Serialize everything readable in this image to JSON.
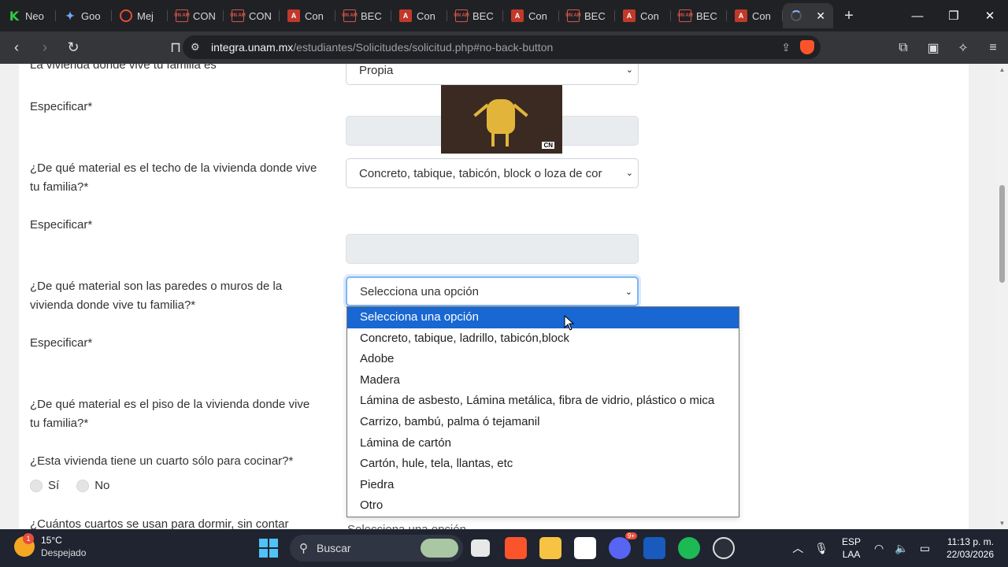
{
  "browser": {
    "tabs": [
      {
        "label": "Neo",
        "icon": "k-logo-icon"
      },
      {
        "label": "Goo",
        "icon": "gemini-star-icon"
      },
      {
        "label": "Mej",
        "icon": "record-icon"
      },
      {
        "label": "CON",
        "icon": "unam-icon"
      },
      {
        "label": "CON",
        "icon": "unam-icon"
      },
      {
        "label": "Con",
        "icon": "pdf-icon"
      },
      {
        "label": "BEC",
        "icon": "unam-icon"
      },
      {
        "label": "Con",
        "icon": "pdf-icon"
      },
      {
        "label": "BEC",
        "icon": "unam-icon"
      },
      {
        "label": "Con",
        "icon": "pdf-icon"
      },
      {
        "label": "BEC",
        "icon": "unam-icon"
      },
      {
        "label": "Con",
        "icon": "pdf-icon"
      },
      {
        "label": "BEC",
        "icon": "unam-icon"
      },
      {
        "label": "Con",
        "icon": "pdf-icon"
      }
    ],
    "url_domain": "integra.unam.mx",
    "url_path": "/estudiantes/Solicitudes/solicitud.php#no-back-button"
  },
  "form": {
    "q_vivienda_label": "La vivienda donde vive tu familia es",
    "q_vivienda_value": "Propia",
    "especificar1": "Especificar*",
    "q_techo_label": "¿De qué material es el techo de la vivienda donde vive tu familia?*",
    "q_techo_value": "Concreto, tabique, tabicón, block o loza de cor",
    "especificar2": "Especificar*",
    "q_paredes_label": "¿De qué material son las paredes o muros de la vivienda donde vive tu familia?*",
    "q_paredes_value": "Selecciona una opción",
    "especificar3": "Especificar*",
    "q_piso_label": "¿De qué material es el piso de la vivienda donde vive tu familia?*",
    "q_cocina_label": "¿Esta vivienda tiene un cuarto sólo para cocinar?*",
    "radio_si": "Sí",
    "radio_no": "No",
    "q_cuartos_label": "¿Cuántos cuartos se usan para dormir, sin contar",
    "q_cuartos_value": "Selecciona una opción",
    "gif_logo": "CN"
  },
  "dropdown": {
    "options": [
      "Selecciona una opción",
      "Concreto, tabique, ladrillo, tabicón,block",
      "Adobe",
      "Madera",
      "Lámina de asbesto, Lámina metálica, fibra de vidrio, plástico o mica",
      "Carrizo, bambú, palma ó tejamanil",
      "Lámina de cartón",
      "Cartón, hule, tela, llantas, etc",
      "Piedra",
      "Otro"
    ],
    "selected_index": 0
  },
  "taskbar": {
    "weather_badge": "1",
    "temperature": "15°C",
    "condition": "Despejado",
    "search_placeholder": "Buscar",
    "discord_badge": "9+",
    "lang_top": "ESP",
    "lang_bottom": "LAA",
    "time": "11:13 p. m.",
    "date": "22/03/2026"
  },
  "colors": {
    "accent": "#1967d2",
    "tab_bg": "#202124",
    "toolbar_bg": "#35363a",
    "taskbar_bg": "#1f2430"
  }
}
